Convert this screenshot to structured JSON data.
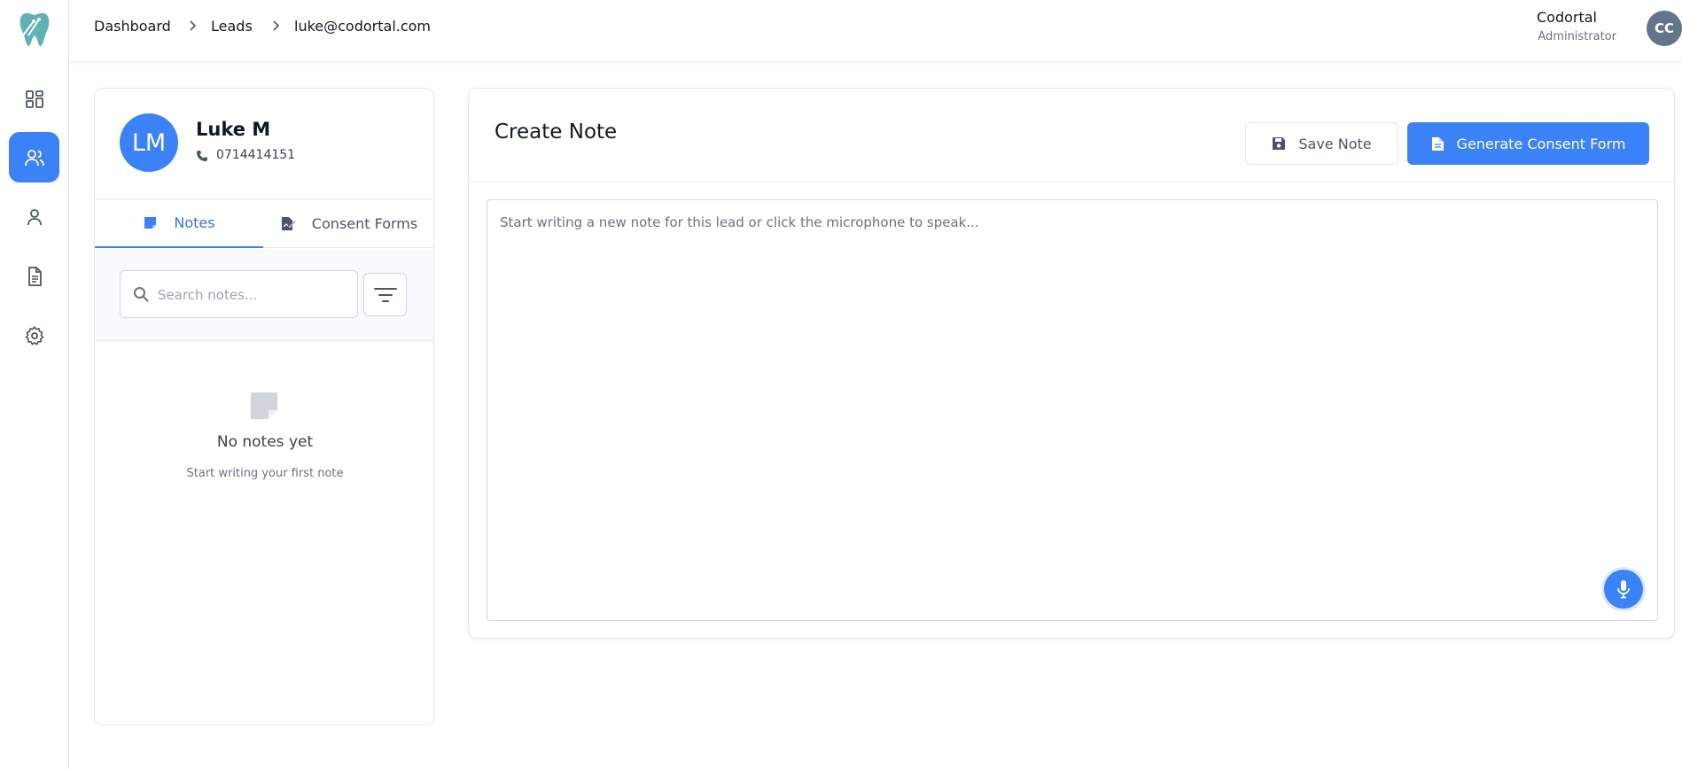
{
  "sidebar": {
    "logo": "tooth-logo",
    "items": [
      {
        "icon": "dashboard-icon",
        "active": false
      },
      {
        "icon": "users-icon",
        "active": true
      },
      {
        "icon": "user-icon",
        "active": false
      },
      {
        "icon": "document-icon",
        "active": false
      },
      {
        "icon": "gear-icon",
        "active": false
      }
    ]
  },
  "header": {
    "breadcrumb": [
      "Dashboard",
      "Leads",
      "luke@codortal.com"
    ],
    "user_name": "Codortal",
    "user_role": "Administrator",
    "user_initials": "CC"
  },
  "lead": {
    "initials": "LM",
    "name": "Luke M",
    "phone": "0714414151"
  },
  "tabs": [
    {
      "label": "Notes",
      "active": true
    },
    {
      "label": "Consent Forms",
      "active": false
    }
  ],
  "search": {
    "placeholder": "Search notes...",
    "value": ""
  },
  "empty_state": {
    "title": "No notes yet",
    "subtitle": "Start writing your first note"
  },
  "note_editor": {
    "title": "Create Note",
    "save_label": "Save Note",
    "generate_label": "Generate Consent Form",
    "placeholder": "Start writing a new note for this lead or click the microphone to speak...",
    "value": ""
  },
  "colors": {
    "accent": "#3b82f6",
    "avatar_header": "#64748b",
    "logo": "#5fb3b0"
  }
}
